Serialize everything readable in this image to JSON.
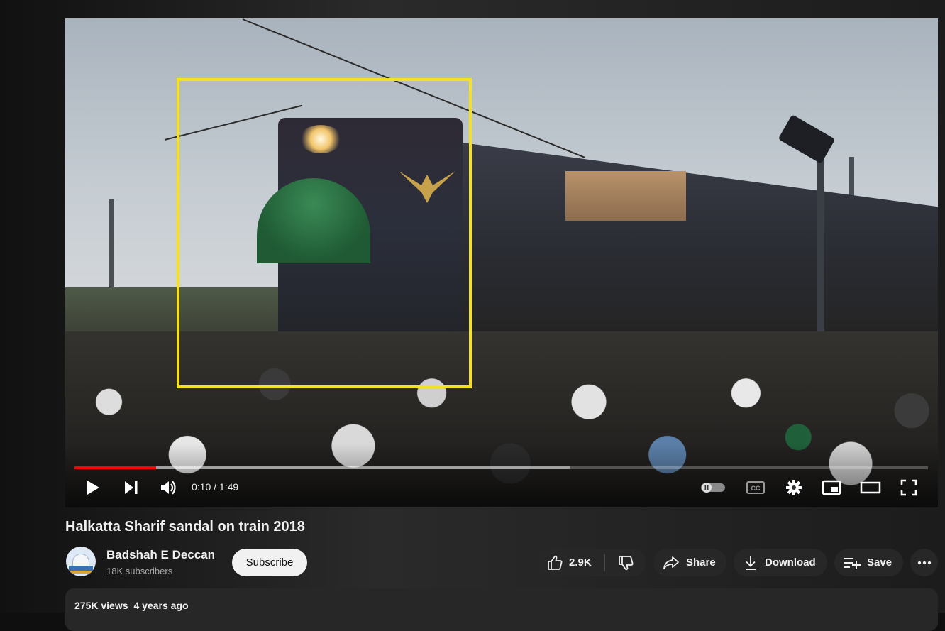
{
  "player": {
    "time_current": "0:10",
    "time_separator": " / ",
    "time_total": "1:49",
    "progress_played_fraction": 0.096,
    "progress_buffered_fraction": 0.58,
    "highlight_color": "#f7e11b",
    "accent_color": "#ff0000"
  },
  "controls": {
    "left": [
      "play-icon",
      "next-icon",
      "volume-icon"
    ],
    "right": [
      "autoplay-toggle-icon",
      "captions-icon",
      "settings-gear-icon",
      "miniplayer-icon",
      "theater-mode-icon",
      "fullscreen-icon"
    ]
  },
  "video": {
    "title": "Halkatta Sharif sandal on train 2018"
  },
  "channel": {
    "name": "Badshah E Deccan",
    "subscribers": "18K subscribers",
    "subscribe_label": "Subscribe"
  },
  "actions": {
    "like_count": "2.9K",
    "share_label": "Share",
    "download_label": "Download",
    "save_label": "Save"
  },
  "description": {
    "views": "275K views",
    "age": "4 years ago"
  }
}
